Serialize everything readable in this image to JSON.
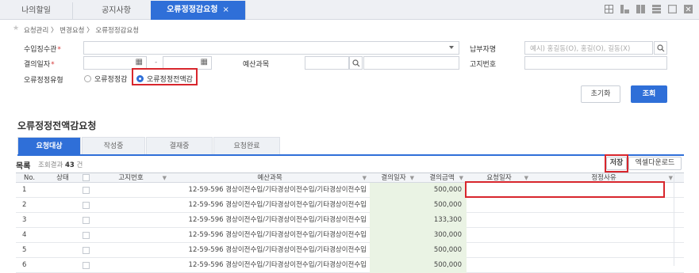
{
  "tabs": [
    {
      "label": "나의할일"
    },
    {
      "label": "공지사항"
    },
    {
      "label": "오류정정감요청",
      "close": "×"
    }
  ],
  "breadcrumb": "요청관리 〉 변경요청 〉 오류정정감요청",
  "form": {
    "collector_label": "수입징수관",
    "payer_label": "납부자명",
    "payer_placeholder": "예시) 홍길동(O), 홍길(O), 길동(X)",
    "decision_date_label": "결의일자",
    "date_sep": "-",
    "budget_label": "예산과목",
    "notice_label": "고지번호",
    "error_type_label": "오류정정유형",
    "radio_partial": "오류정정감",
    "radio_full": "오류정정전액감",
    "required_mark": "*"
  },
  "buttons": {
    "reset": "초기화",
    "search": "조회",
    "save": "저장",
    "excel": "엑셀다운로드"
  },
  "section_title": "오류정정전액감요청",
  "subtabs": [
    "요청대상",
    "작성중",
    "결재중",
    "요청완료"
  ],
  "list": {
    "title": "목록",
    "count_prefix": "조회결과",
    "count": "43",
    "count_suffix": "건"
  },
  "table": {
    "headers": {
      "no": "No.",
      "status": "상태",
      "notice": "고지번호",
      "budget": "예산과목",
      "decision_date": "결의일자",
      "amount": "결의금액",
      "request_date": "요청일자",
      "reason": "정정사유"
    },
    "rows": [
      {
        "no": "1",
        "budget": "12-59-596 경상이전수입/기타경상이전수입/기타경상이전수입",
        "amount": "500,000"
      },
      {
        "no": "2",
        "budget": "12-59-596 경상이전수입/기타경상이전수입/기타경상이전수입",
        "amount": "500,000"
      },
      {
        "no": "3",
        "budget": "12-59-596 경상이전수입/기타경상이전수입/기타경상이전수입",
        "amount": "133,300"
      },
      {
        "no": "4",
        "budget": "12-59-596 경상이전수입/기타경상이전수입/기타경상이전수입",
        "amount": "300,000"
      },
      {
        "no": "5",
        "budget": "12-59-596 경상이전수입/기타경상이전수입/기타경상이전수입",
        "amount": "500,000"
      },
      {
        "no": "6",
        "budget": "12-59-596 경상이전수입/기타경상이전수입/기타경상이전수입",
        "amount": "500,000"
      }
    ]
  },
  "colors": {
    "accent": "#2f6fd8",
    "highlight": "#d8262d",
    "amount_bg": "#eaf3e4"
  }
}
